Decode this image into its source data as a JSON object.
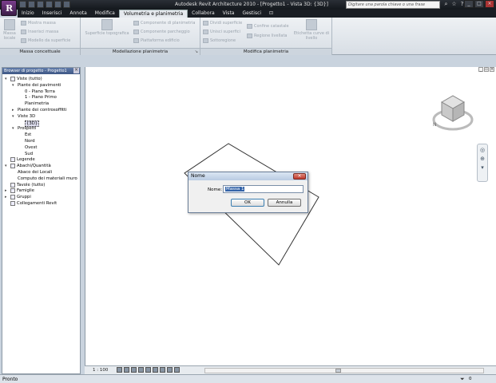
{
  "window": {
    "title": "Autodesk Revit Architecture 2010 - [Progetto1 - Vista 3D: {3D}]",
    "search_placeholder": "Digitare una parola chiave o una frase"
  },
  "tabs": [
    "Inizio",
    "Inserisci",
    "Annota",
    "Modifica",
    "Volumetria e planimetria",
    "Collabora",
    "Vista",
    "Gestisci"
  ],
  "active_tab": "Volumetria e planimetria",
  "ribbon": {
    "groups": [
      {
        "label": "Massa concettuale",
        "big_item": "Massa locale",
        "items": [
          "Mostra massa",
          "Inserisci massa",
          "Modello da superficie"
        ]
      },
      {
        "label": "Modellazione planimetria",
        "big_item": "Superficie topografica",
        "items": [
          "Componente di planimetria",
          "Componente parcheggio",
          "Piattaforma edificio"
        ]
      },
      {
        "label": "Modifica planimetria",
        "items": [
          "Dividi superficie",
          "Unisci superfici",
          "Sottoregione",
          "Confine catastale",
          "Regione livellata"
        ],
        "big_item": "Etichetta curve di livello"
      }
    ]
  },
  "browser": {
    "title": "Browser di progetto - Progetto1",
    "tree": [
      {
        "label": "Viste (tutto)",
        "level": 0,
        "icon": "views-icon",
        "exp": "-"
      },
      {
        "label": "Piante dei pavimenti",
        "level": 1,
        "exp": "-"
      },
      {
        "label": "0 - Piano Terra",
        "level": 2
      },
      {
        "label": "1 - Piano Primo",
        "level": 2
      },
      {
        "label": "Planimetria",
        "level": 2
      },
      {
        "label": "Piante dei controsoffitti",
        "level": 1,
        "exp": "+"
      },
      {
        "label": "Viste 3D",
        "level": 1,
        "exp": "-"
      },
      {
        "label": "{3D}",
        "level": 2,
        "selected": true
      },
      {
        "label": "Prospetti",
        "level": 1,
        "exp": "-"
      },
      {
        "label": "Est",
        "level": 2
      },
      {
        "label": "Nord",
        "level": 2
      },
      {
        "label": "Ovest",
        "level": 2
      },
      {
        "label": "Sud",
        "level": 2
      },
      {
        "label": "Legende",
        "level": 0,
        "icon": "legend-icon"
      },
      {
        "label": "Abachi/Quantità",
        "level": 0,
        "icon": "schedule-icon",
        "exp": "-"
      },
      {
        "label": "Abaco dei Locali",
        "level": 1
      },
      {
        "label": "Computo dei materiali muro",
        "level": 1
      },
      {
        "label": "Tavole (tutto)",
        "level": 0,
        "icon": "sheets-icon"
      },
      {
        "label": "Famiglie",
        "level": 0,
        "icon": "families-icon",
        "exp": "+"
      },
      {
        "label": "Gruppi",
        "level": 0,
        "icon": "groups-icon",
        "exp": "+"
      },
      {
        "label": "Collegamenti Revit",
        "level": 0,
        "icon": "links-icon"
      }
    ]
  },
  "viewbar": {
    "scale": "1 : 100"
  },
  "status": {
    "text": "Pronto",
    "filter_count": "0"
  },
  "dialog": {
    "title": "Nome",
    "label": "Nome:",
    "value": "Massa 1",
    "ok": "OK",
    "cancel": "Annulla"
  },
  "colors": {
    "selection": "#3363a8",
    "app_button": "#6b3a7d"
  }
}
